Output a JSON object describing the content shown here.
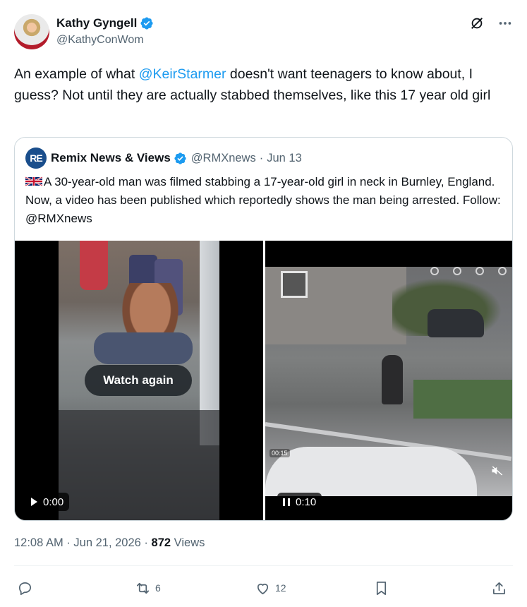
{
  "author": {
    "display_name": "Kathy Gyngell",
    "handle": "@KathyConWom"
  },
  "tweet": {
    "text_before": "An example of what ",
    "mention": "@KeirStarmer",
    "text_after": " doesn't want teenagers to know about, I guess? Not until they are actually stabbed themselves, like this 17 year old girl"
  },
  "quoted": {
    "logo_text": "RE",
    "display_name": "Remix News & Views",
    "handle": "@RMXnews",
    "separator": "·",
    "date": "Jun 13",
    "text": "A 30-year-old man was filmed stabbing a 17-year-old girl in neck in Burnley, England. Now, a video has been published which reportedly shows the man being arrested. Follow: @RMXnews",
    "media": {
      "left": {
        "overlay_button": "Watch again",
        "time": "0:00"
      },
      "right": {
        "time": "0:10",
        "timestamp_overlay": "00:15"
      }
    }
  },
  "meta": {
    "time": "12:08 AM",
    "sep1": "·",
    "date": "Jun 21, 2026",
    "sep2": "·",
    "views_count": "872",
    "views_label": "Views"
  },
  "actions": {
    "reply": {
      "icon": "reply-icon",
      "count": ""
    },
    "repost": {
      "icon": "repost-icon",
      "count": "6"
    },
    "like": {
      "icon": "heart-icon",
      "count": "12"
    },
    "bookmark": {
      "icon": "bookmark-icon",
      "count": ""
    },
    "share": {
      "icon": "share-icon",
      "count": ""
    }
  },
  "colors": {
    "accent": "#1d9bf0",
    "text": "#0f1419",
    "secondary": "#536471",
    "border": "#cfd9de"
  }
}
